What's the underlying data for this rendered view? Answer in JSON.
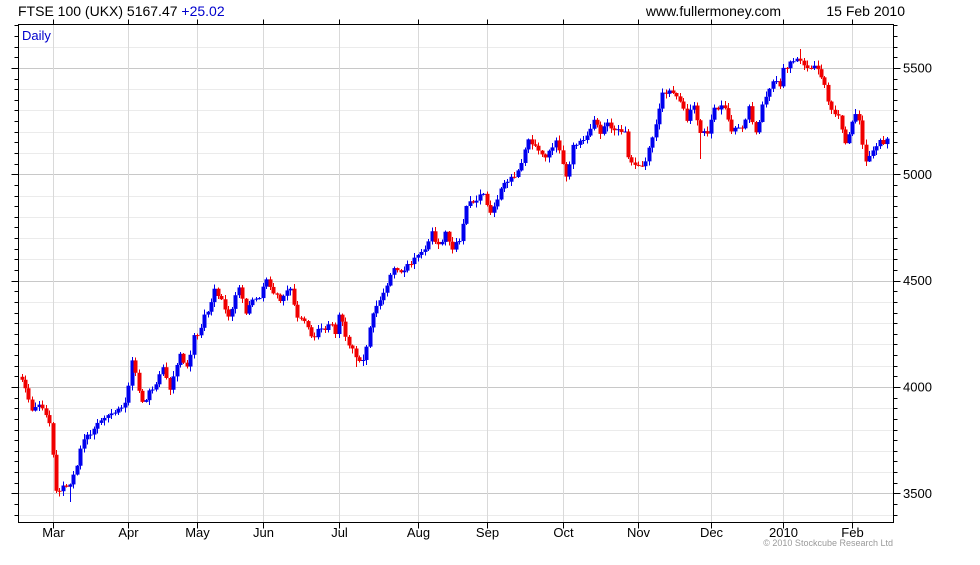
{
  "header": {
    "title": "FTSE 100 (UKX) 5167.47",
    "change": "+25.02",
    "website": "www.fullermoney.com",
    "date": "15 Feb 2010"
  },
  "frequency_label": "Daily",
  "copyright": "© 2010 Stockcube Research Ltd",
  "chart_data": {
    "type": "candlestick",
    "title": "FTSE 100 (UKX)",
    "frequency": "Daily",
    "last_close": 5167.47,
    "change": 25.02,
    "as_of_date": "15 Feb 2010",
    "ylim": [
      3363,
      5704
    ],
    "y_major_ticks": [
      3500,
      4000,
      4500,
      5000,
      5500
    ],
    "grid_step": 100,
    "minor_tick_step": 50,
    "days_total": 252,
    "x_months": [
      {
        "label": "Mar",
        "day": 9
      },
      {
        "label": "Apr",
        "day": 31
      },
      {
        "label": "May",
        "day": 51
      },
      {
        "label": "Jun",
        "day": 70
      },
      {
        "label": "Jul",
        "day": 92
      },
      {
        "label": "Aug",
        "day": 115
      },
      {
        "label": "Sep",
        "day": 135
      },
      {
        "label": "Oct",
        "day": 157
      },
      {
        "label": "Nov",
        "day": 179
      },
      {
        "label": "Dec",
        "day": 200
      },
      {
        "label": "2010",
        "day": 221
      },
      {
        "label": "Feb",
        "day": 241
      }
    ],
    "anchors": [
      [
        0,
        4034
      ],
      [
        3,
        3889
      ],
      [
        5,
        3917
      ],
      [
        8,
        3830
      ],
      [
        10,
        3512
      ],
      [
        13,
        3531
      ],
      [
        14,
        3542
      ],
      [
        18,
        3754
      ],
      [
        23,
        3843
      ],
      [
        28,
        3898
      ],
      [
        30,
        3926
      ],
      [
        32,
        4125
      ],
      [
        35,
        3930
      ],
      [
        37,
        3984
      ],
      [
        38,
        3988
      ],
      [
        41,
        4093
      ],
      [
        43,
        3987
      ],
      [
        46,
        4156
      ],
      [
        48,
        4096
      ],
      [
        50,
        4244
      ],
      [
        51,
        4243
      ],
      [
        55,
        4399
      ],
      [
        56,
        4462
      ],
      [
        60,
        4331
      ],
      [
        63,
        4468
      ],
      [
        65,
        4345
      ],
      [
        67,
        4411
      ],
      [
        69,
        4418
      ],
      [
        71,
        4506
      ],
      [
        75,
        4404
      ],
      [
        78,
        4462
      ],
      [
        80,
        4326
      ],
      [
        83,
        4281
      ],
      [
        85,
        4234
      ],
      [
        87,
        4275
      ],
      [
        90,
        4294
      ],
      [
        91,
        4249
      ],
      [
        92,
        4340
      ],
      [
        94,
        4236
      ],
      [
        97,
        4140
      ],
      [
        99,
        4127
      ],
      [
        102,
        4346
      ],
      [
        105,
        4443
      ],
      [
        108,
        4559
      ],
      [
        111,
        4547
      ],
      [
        114,
        4608
      ],
      [
        117,
        4647
      ],
      [
        119,
        4732
      ],
      [
        121,
        4671
      ],
      [
        123,
        4730
      ],
      [
        125,
        4646
      ],
      [
        127,
        4686
      ],
      [
        129,
        4851
      ],
      [
        132,
        4876
      ],
      [
        134,
        4908
      ],
      [
        136,
        4819
      ],
      [
        139,
        4933
      ],
      [
        142,
        4988
      ],
      [
        144,
        5018
      ],
      [
        147,
        5164
      ],
      [
        149,
        5134
      ],
      [
        152,
        5079
      ],
      [
        155,
        5159
      ],
      [
        157,
        5048
      ],
      [
        158,
        4989
      ],
      [
        160,
        5138
      ],
      [
        163,
        5161
      ],
      [
        166,
        5256
      ],
      [
        168,
        5190
      ],
      [
        170,
        5243
      ],
      [
        172,
        5207
      ],
      [
        175,
        5201
      ],
      [
        176,
        5080
      ],
      [
        178,
        5044
      ],
      [
        180,
        5038
      ],
      [
        182,
        5125
      ],
      [
        184,
        5235
      ],
      [
        186,
        5384
      ],
      [
        189,
        5382
      ],
      [
        191,
        5342
      ],
      [
        193,
        5251
      ],
      [
        195,
        5323
      ],
      [
        197,
        5194
      ],
      [
        199,
        5191
      ],
      [
        201,
        5313
      ],
      [
        204,
        5311
      ],
      [
        206,
        5201
      ],
      [
        209,
        5216
      ],
      [
        211,
        5320
      ],
      [
        213,
        5197
      ],
      [
        215,
        5328
      ],
      [
        217,
        5402
      ],
      [
        218,
        5437
      ],
      [
        220,
        5413
      ],
      [
        221,
        5500
      ],
      [
        223,
        5530
      ],
      [
        226,
        5534
      ],
      [
        229,
        5498
      ],
      [
        231,
        5494
      ],
      [
        233,
        5420
      ],
      [
        235,
        5303
      ],
      [
        237,
        5276
      ],
      [
        239,
        5146
      ],
      [
        240,
        5188
      ],
      [
        241,
        5247
      ],
      [
        242,
        5283
      ],
      [
        243,
        5253
      ],
      [
        244,
        5139
      ],
      [
        245,
        5060
      ],
      [
        246,
        5086
      ],
      [
        247,
        5112
      ],
      [
        248,
        5132
      ],
      [
        249,
        5161
      ],
      [
        250,
        5142
      ],
      [
        251,
        5167.47
      ]
    ],
    "specials": [
      {
        "day": 14,
        "low": 3460
      },
      {
        "day": 97,
        "low": 4093
      },
      {
        "day": 197,
        "low": 5072
      },
      {
        "day": 226,
        "high": 5590
      }
    ],
    "colors": {
      "up": "#0000ee",
      "down": "#f00000",
      "grid_minor": "#ebebeb",
      "grid_major": "#c8c8c8",
      "grid_vertical": "#d9d9d9",
      "axis": "#000000",
      "label": "#000000"
    }
  }
}
